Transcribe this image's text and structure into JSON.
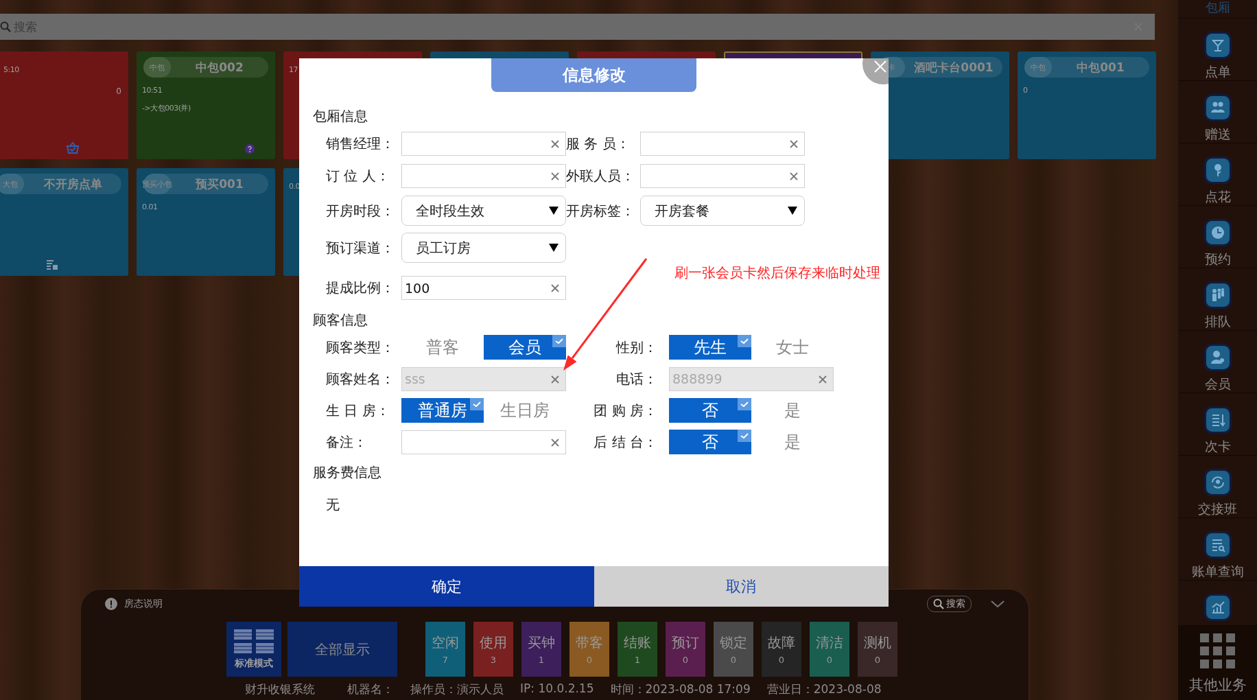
{
  "search": {
    "placeholder": "搜索"
  },
  "room_rows": [
    {
      "cards": [
        {
          "kind": "ordered",
          "color": "#6e1616",
          "selected": false,
          "lines": [
            "5:10"
          ],
          "count": "0"
        },
        {
          "kind": "question",
          "color": "#1e3d14",
          "selected": false,
          "tag": "中包",
          "name": "中包002",
          "lines": [
            "10:51",
            "->大包003(并)"
          ]
        },
        {
          "kind": "plain",
          "color": "#6e1616",
          "selected": false,
          "lines": [
            "17"
          ]
        },
        {
          "kind": "plain",
          "color": "#0f4a66",
          "selected": false
        },
        {
          "kind": "plain",
          "color": "#6e1616",
          "selected": false
        },
        {
          "kind": "plain",
          "color": "#3a1a55",
          "selected": true
        },
        {
          "kind": "plain",
          "color": "#0f4a66",
          "selected": false,
          "tag": "卡",
          "name": "酒吧卡台0001"
        },
        {
          "kind": "plain",
          "color": "#0f4a66",
          "selected": false,
          "tag": "中包",
          "name": "中包001",
          "lines": [
            "0"
          ]
        }
      ]
    },
    {
      "cards": [
        {
          "kind": "pending",
          "color": "#0f4a66",
          "selected": false,
          "tag": "大包",
          "name": "不开房点单"
        },
        {
          "kind": "plain",
          "color": "#0f4a66",
          "selected": false,
          "tag": "预买小包",
          "name": "预买001",
          "lines": [
            "0.01"
          ]
        },
        {
          "kind": "plain",
          "color": "#0f4a66",
          "selected": false,
          "lines": [
            "0.0"
          ]
        }
      ]
    }
  ],
  "sidebar": {
    "header": "包厢",
    "items": [
      {
        "kind": "button",
        "label": "点单"
      },
      {
        "kind": "button",
        "label": "赠送"
      },
      {
        "kind": "button",
        "label": "点花"
      },
      {
        "kind": "button",
        "label": "预约"
      },
      {
        "kind": "button",
        "label": "排队"
      },
      {
        "kind": "button",
        "label": "会员"
      },
      {
        "kind": "button",
        "label": "次卡"
      },
      {
        "kind": "button",
        "label": "交接班"
      },
      {
        "kind": "button",
        "label": "账单查询"
      },
      {
        "kind": "icon_only"
      }
    ],
    "more": {
      "label": "其他业务"
    }
  },
  "dialog": {
    "title": "信息修改",
    "sections": [
      {
        "kind": "room",
        "heading": "包厢信息",
        "rows": [
          {
            "cells": [
              {
                "label": "销售经理：",
                "kind": "input",
                "disabled": false
              },
              {
                "label": "服 务 员：",
                "kind": "input",
                "disabled": false
              }
            ]
          },
          {
            "cells": [
              {
                "label": "订 位 人：",
                "kind": "input",
                "disabled": false
              },
              {
                "label": "外联人员：",
                "kind": "input",
                "disabled": false
              }
            ]
          },
          {
            "cells": [
              {
                "label": "开房时段：",
                "kind": "select",
                "value": "全时段生效"
              },
              {
                "label": "开房标签：",
                "kind": "select",
                "value": "开房套餐"
              }
            ]
          },
          {
            "cells": [
              {
                "label": "预订渠道：",
                "kind": "select",
                "value": "员工订房"
              }
            ]
          },
          {
            "cells": [
              {
                "label": "提成比例：",
                "kind": "input",
                "value": "100",
                "disabled": false
              }
            ]
          }
        ]
      },
      {
        "kind": "customer",
        "heading": "顾客信息",
        "rows": [
          {
            "cells": [
              {
                "label": "顾客类型：",
                "kind": "choice",
                "options": [
                  {
                    "label": "普客",
                    "selected": false
                  },
                  {
                    "label": "会员",
                    "selected": true
                  }
                ]
              },
              {
                "label": "性别：",
                "kind": "choice",
                "options": [
                  {
                    "label": "先生",
                    "selected": true
                  },
                  {
                    "label": "女士",
                    "selected": false
                  }
                ]
              }
            ]
          },
          {
            "cells": [
              {
                "label": "顾客姓名：",
                "kind": "input",
                "placeholder": "sss",
                "disabled": true
              },
              {
                "label": "电话：",
                "kind": "input",
                "placeholder": "888899",
                "disabled": true
              }
            ]
          },
          {
            "cells": [
              {
                "label": "生 日 房：",
                "kind": "choice",
                "options": [
                  {
                    "label": "普通房",
                    "selected": true
                  },
                  {
                    "label": "生日房",
                    "selected": false
                  }
                ]
              },
              {
                "label": "团 购 房：",
                "kind": "choice",
                "options": [
                  {
                    "label": "否",
                    "selected": true
                  },
                  {
                    "label": "是",
                    "selected": false
                  }
                ]
              }
            ]
          },
          {
            "cells": [
              {
                "label": "备注：",
                "kind": "input",
                "disabled": false
              },
              {
                "label": "后 结 台：",
                "kind": "choice",
                "options": [
                  {
                    "label": "否",
                    "selected": true
                  },
                  {
                    "label": "是",
                    "selected": false
                  }
                ]
              }
            ]
          }
        ]
      },
      {
        "kind": "note",
        "heading": "服务费信息",
        "text": "无"
      }
    ],
    "buttons": [
      {
        "label": "确定",
        "kind": "primary"
      },
      {
        "label": "取消",
        "kind": "secondary"
      }
    ]
  },
  "annotation": {
    "text": "刷一张会员卡然后保存来临时处理"
  },
  "bottom_panel": {
    "legend": "房态说明",
    "search": "搜索",
    "mode": "标准模式",
    "show_all": "全部显示",
    "statuses": [
      {
        "label": "空闲",
        "count": "7",
        "color": "#0f5f78"
      },
      {
        "label": "使用",
        "count": "3",
        "color": "#7a2020"
      },
      {
        "label": "买钟",
        "count": "1",
        "color": "#3d1f5c"
      },
      {
        "label": "带客",
        "count": "0",
        "color": "#8a5a22"
      },
      {
        "label": "结账",
        "count": "1",
        "color": "#1f4a1f"
      },
      {
        "label": "预订",
        "count": "0",
        "color": "#5a1f4f"
      },
      {
        "label": "锁定",
        "count": "0",
        "color": "#4a4a4a"
      },
      {
        "label": "故障",
        "count": "0",
        "color": "#252525"
      },
      {
        "label": "清洁",
        "count": "0",
        "color": "#1a5e50"
      },
      {
        "label": "测机",
        "count": "0",
        "color": "#3a2828"
      }
    ],
    "footer": [
      "财升收银系统",
      "机器名：",
      "操作员：演示人员",
      "IP: 10.0.2.15",
      "时间：2023-08-08 17:09",
      "营业日：2023-08-08"
    ]
  }
}
